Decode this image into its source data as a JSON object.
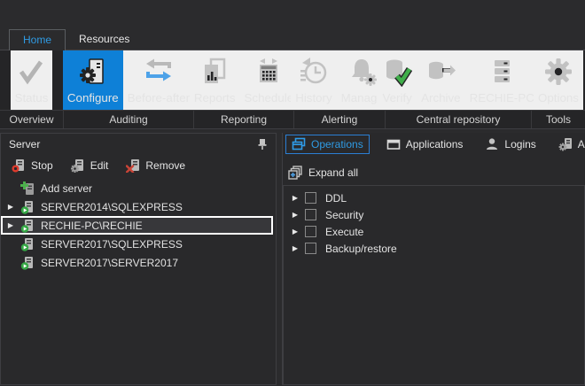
{
  "colors": {
    "accent_text_blue": "#2f9be4",
    "selected_button_blue": "#0e80d7",
    "tab_border_blue": "#2b7fd4",
    "status_green": "#3fae4a",
    "stop_red": "#dd3a2c",
    "panel_border": "#3e3e42"
  },
  "tab_bar": {
    "tabs": [
      {
        "label": "Home",
        "selected": true
      },
      {
        "label": "Resources",
        "selected": false
      }
    ]
  },
  "ribbon": {
    "groups": [
      {
        "label": "Overview",
        "buttons": [
          {
            "label": "Status",
            "icon": "check-icon",
            "selected": false
          }
        ]
      },
      {
        "label": "Auditing",
        "buttons": [
          {
            "label": "Configure",
            "icon": "configure-server-icon",
            "selected": true
          },
          {
            "label": "Before-after",
            "icon": "swap-arrows-icon",
            "selected": false
          }
        ]
      },
      {
        "label": "Reporting",
        "buttons": [
          {
            "label": "Reports",
            "icon": "report-pages-icon",
            "selected": false
          },
          {
            "label": "Schedule",
            "icon": "calendar-icon",
            "selected": false
          }
        ]
      },
      {
        "label": "Alerting",
        "buttons": [
          {
            "label": "History",
            "icon": "history-clock-icon",
            "selected": false
          },
          {
            "label": "Manage",
            "icon": "bell-gear-icon",
            "selected": false
          }
        ]
      },
      {
        "label": "Central repository",
        "buttons": [
          {
            "label": "Verify",
            "icon": "database-check-icon",
            "selected": false
          },
          {
            "label": "Archive",
            "icon": "database-arrow-icon",
            "selected": false
          },
          {
            "label": "RECHIE-PC",
            "icon": "server-rack-icon",
            "selected": false
          }
        ]
      },
      {
        "label": "Tools",
        "buttons": [
          {
            "label": "Options",
            "icon": "gear-icon",
            "selected": false
          }
        ]
      }
    ]
  },
  "server_panel": {
    "title": "Server",
    "pin_icon": "pin-icon",
    "toolbar": [
      {
        "label": "Stop",
        "icon": "server-stop-icon"
      },
      {
        "label": "Edit",
        "icon": "server-gear-icon"
      },
      {
        "label": "Remove",
        "icon": "server-remove-icon"
      }
    ],
    "tree": [
      {
        "label": "Add server",
        "icon": "add-server-icon",
        "expandable": false,
        "selected": false
      },
      {
        "label": "SERVER2014\\SQLEXPRESS",
        "icon": "server-running-icon",
        "expandable": true,
        "selected": false
      },
      {
        "label": "RECHIE-PC\\RECHIE",
        "icon": "server-running-icon",
        "expandable": true,
        "selected": true
      },
      {
        "label": "SERVER2017\\SQLEXPRESS",
        "icon": "server-running-icon",
        "expandable": false,
        "selected": false
      },
      {
        "label": "SERVER2017\\SERVER2017",
        "icon": "server-running-icon",
        "expandable": false,
        "selected": false
      }
    ]
  },
  "audit_panel": {
    "tabs": [
      {
        "label": "Operations",
        "icon": "cascade-windows-icon",
        "selected": true
      },
      {
        "label": "Applications",
        "icon": "window-icon",
        "selected": false
      },
      {
        "label": "Logins",
        "icon": "user-icon",
        "selected": false
      },
      {
        "label": "All",
        "icon": "server-gear-icon",
        "selected": false
      }
    ],
    "expand_all": "Expand all",
    "tree": [
      {
        "label": "DDL",
        "checked": false,
        "expandable": true
      },
      {
        "label": "Security",
        "checked": false,
        "expandable": true
      },
      {
        "label": "Execute",
        "checked": false,
        "expandable": true
      },
      {
        "label": "Backup/restore",
        "checked": false,
        "expandable": true
      }
    ]
  }
}
